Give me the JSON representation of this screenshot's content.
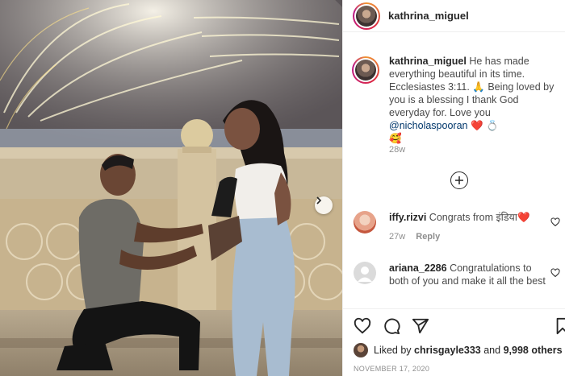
{
  "post": {
    "username": "kathrina_miguel",
    "caption_user": "kathrina_miguel",
    "caption_text": "He has made everything beautiful in its time. Ecclesiastes 3:11. 🙏 Being loved by you is a blessing I thank God everyday for. Love you",
    "caption_mention": "@nicholaspooran",
    "caption_emoji": "❤️ 💍",
    "caption_emoji2": "🥰",
    "caption_time": "28w"
  },
  "comments": [
    {
      "user": "iffy.rizvi",
      "text": "Congrats from इंडिया",
      "emoji": "❤️",
      "time": "27w",
      "reply": "Reply",
      "avatar_color": "#e7a38a"
    },
    {
      "user": "ariana_2286",
      "text": "Congratulations to both of you and make it all the best",
      "emoji": "",
      "time": "",
      "reply": "",
      "avatar_color": "#dbdbdb"
    }
  ],
  "likes": {
    "prefix": "Liked by",
    "user": "chrisgayle333",
    "middle": "and",
    "count": "9,998 others"
  },
  "date": "NOVEMBER 17, 2020",
  "icons": {
    "like": "heart-icon",
    "comment": "comment-icon",
    "share": "share-icon",
    "save": "bookmark-icon",
    "load_more": "plus-circle-icon",
    "next": "chevron-right-icon"
  }
}
